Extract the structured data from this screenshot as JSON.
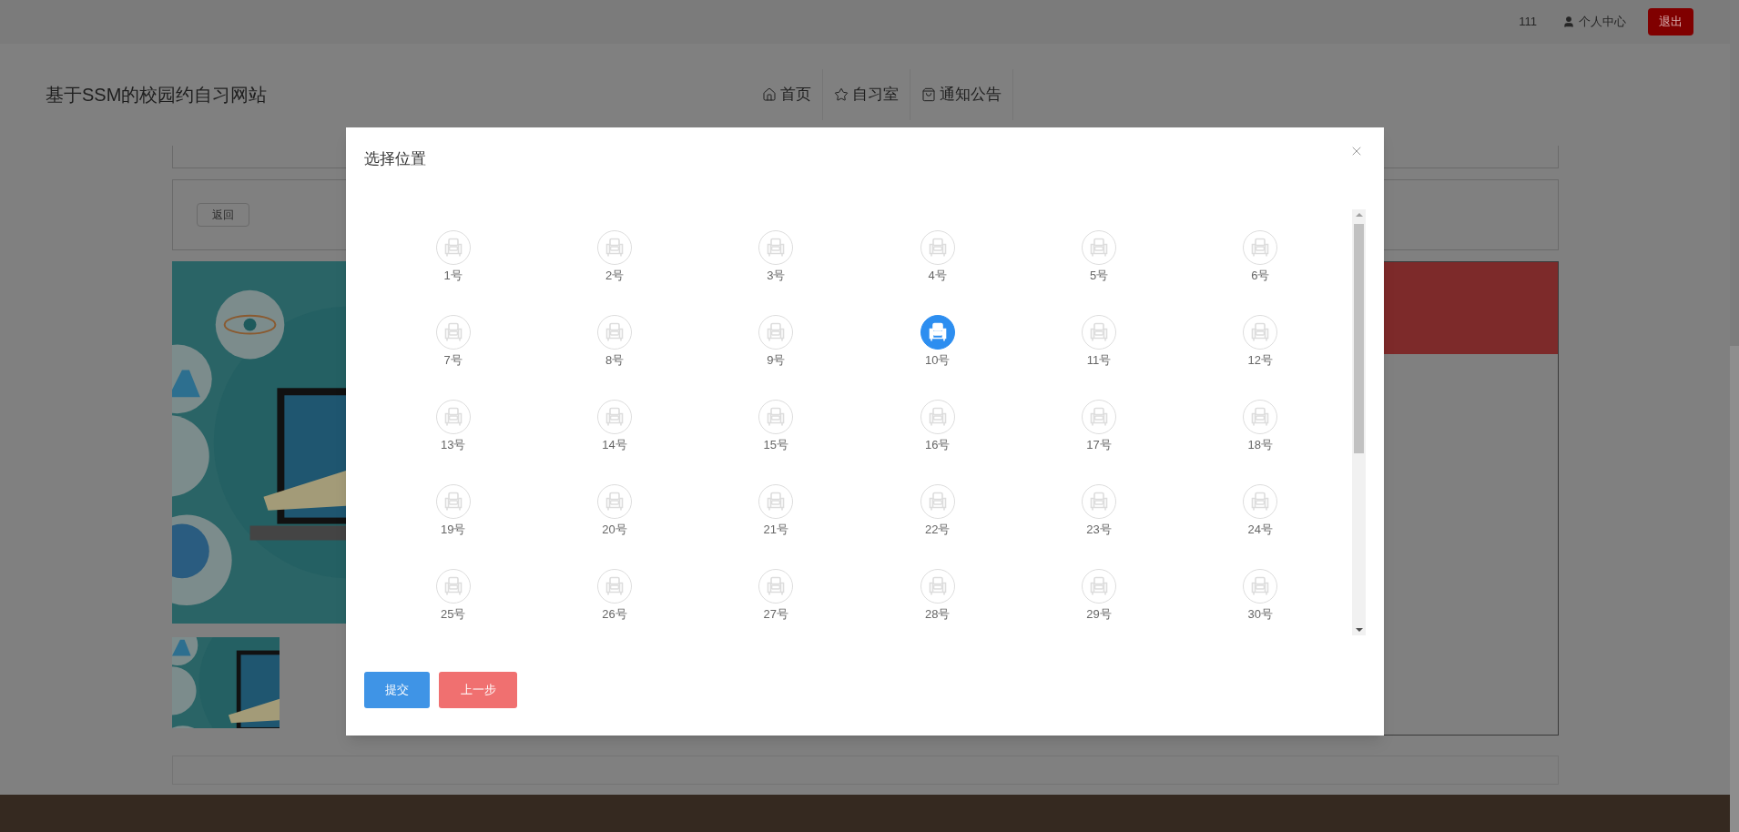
{
  "topbar": {
    "username": "111",
    "profile_link": "个人中心",
    "logout_button": "退出"
  },
  "header": {
    "site_title": "基于SSM的校园约自习网站",
    "nav": [
      {
        "label": "首页",
        "kind": "home"
      },
      {
        "label": "自习室",
        "kind": "star"
      },
      {
        "label": "通知公告",
        "kind": "bag"
      }
    ]
  },
  "page": {
    "back_button": "返回"
  },
  "dialog": {
    "title": "选择位置",
    "seats": [
      {
        "label": "1号",
        "selected": false
      },
      {
        "label": "2号",
        "selected": false
      },
      {
        "label": "3号",
        "selected": false
      },
      {
        "label": "4号",
        "selected": false
      },
      {
        "label": "5号",
        "selected": false
      },
      {
        "label": "6号",
        "selected": false
      },
      {
        "label": "7号",
        "selected": false
      },
      {
        "label": "8号",
        "selected": false
      },
      {
        "label": "9号",
        "selected": false
      },
      {
        "label": "10号",
        "selected": true
      },
      {
        "label": "11号",
        "selected": false
      },
      {
        "label": "12号",
        "selected": false
      },
      {
        "label": "13号",
        "selected": false
      },
      {
        "label": "14号",
        "selected": false
      },
      {
        "label": "15号",
        "selected": false
      },
      {
        "label": "16号",
        "selected": false
      },
      {
        "label": "17号",
        "selected": false
      },
      {
        "label": "18号",
        "selected": false
      },
      {
        "label": "19号",
        "selected": false
      },
      {
        "label": "20号",
        "selected": false
      },
      {
        "label": "21号",
        "selected": false
      },
      {
        "label": "22号",
        "selected": false
      },
      {
        "label": "23号",
        "selected": false
      },
      {
        "label": "24号",
        "selected": false
      },
      {
        "label": "25号",
        "selected": false
      },
      {
        "label": "26号",
        "selected": false
      },
      {
        "label": "27号",
        "selected": false
      },
      {
        "label": "28号",
        "selected": false
      },
      {
        "label": "29号",
        "selected": false
      },
      {
        "label": "30号",
        "selected": false
      }
    ],
    "buttons": [
      {
        "label": "提交",
        "kind": "primary"
      },
      {
        "label": "上一步",
        "kind": "danger"
      }
    ]
  }
}
